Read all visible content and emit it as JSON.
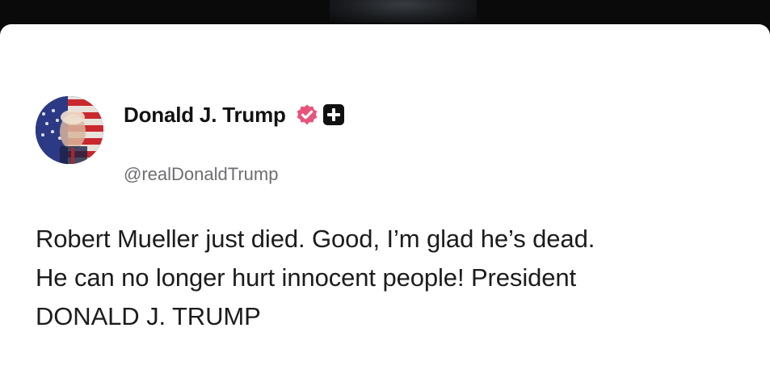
{
  "post": {
    "author": {
      "display_name": "Donald J. Trump",
      "handle": "@realDonaldTrump",
      "avatar_icon": "flag-portrait-avatar",
      "verified_icon": "verified-badge-icon",
      "follow_icon": "plus-icon"
    },
    "text_lines": [
      "Robert Mueller just died. Good, I’m glad he’s dead.",
      "He can no longer hurt innocent people! President",
      "DONALD J. TRUMP"
    ]
  },
  "colors": {
    "badge": "#e8547a",
    "text": "#1c1c1e",
    "handle": "#6e6e73"
  }
}
